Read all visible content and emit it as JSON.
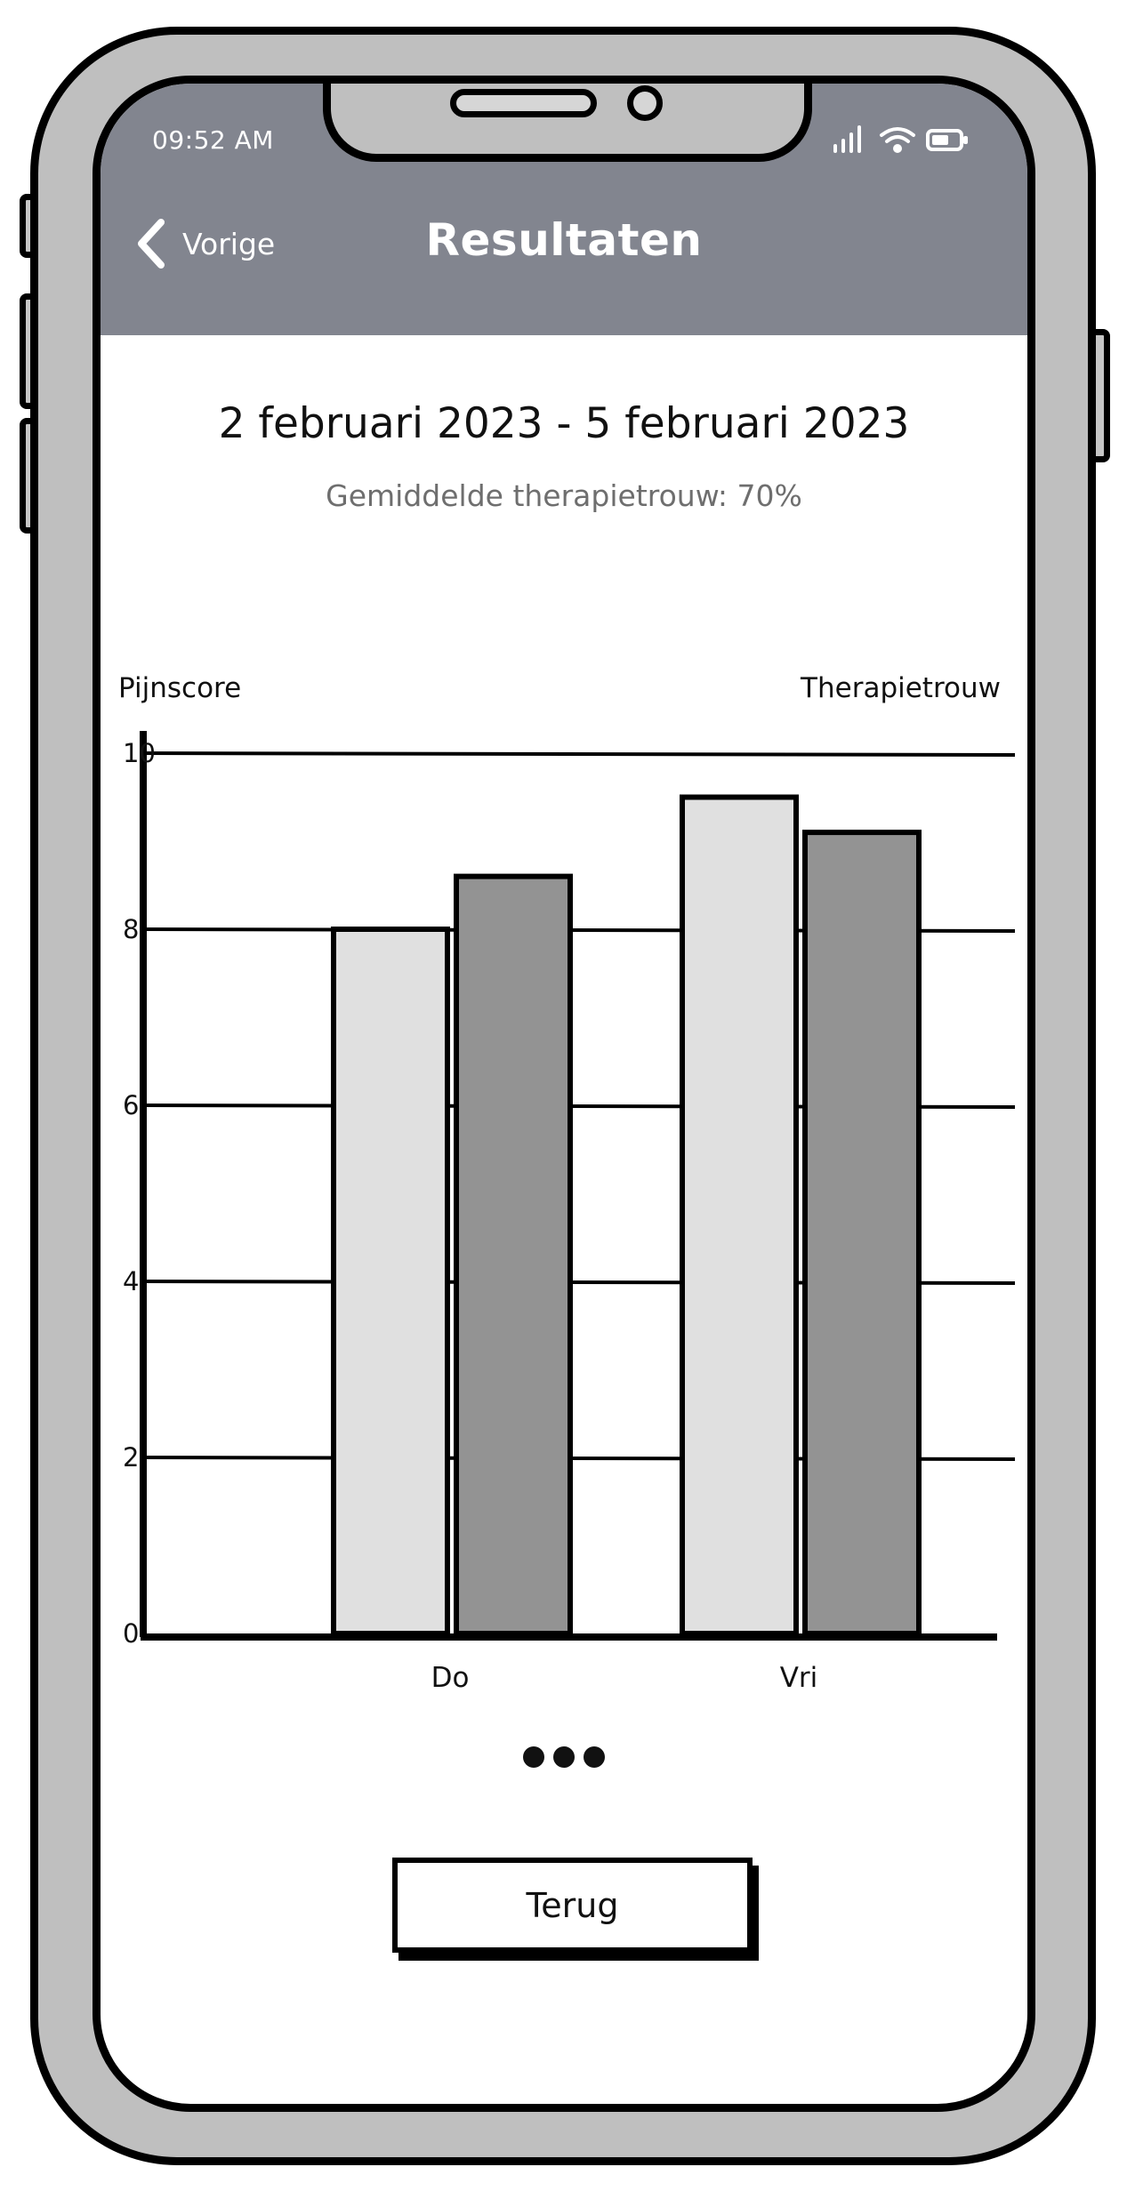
{
  "status_bar": {
    "time": "09:52 AM"
  },
  "header": {
    "back_label": "Vorige",
    "title": "Resultaten"
  },
  "summary": {
    "date_range": "2 februari 2023 - 5 februari 2023",
    "average_line": "Gemiddelde therapietrouw: 70%"
  },
  "chart_data": {
    "type": "bar",
    "left_axis_label": "Pijnscore",
    "right_axis_label": "Therapietrouw",
    "yticks": [
      "0",
      "2",
      "4",
      "6",
      "8",
      "10"
    ],
    "ylim": [
      0,
      10
    ],
    "grid": true,
    "categories": [
      "Do",
      "Vri"
    ],
    "series": [
      {
        "values": [
          8.0,
          9.5
        ],
        "color": "#e0e0e0"
      },
      {
        "values": [
          8.6,
          9.1
        ],
        "color": "#939393"
      }
    ]
  },
  "footer": {
    "more_indicator": "•••",
    "back_button_label": "Terug"
  },
  "colors": {
    "header_bg": "#82858f",
    "phone_frame": "#bfbfbf"
  },
  "icons": {
    "back": "chevron-left-icon",
    "signal": "signal-icon",
    "wifi": "wifi-icon",
    "battery": "battery-icon"
  }
}
